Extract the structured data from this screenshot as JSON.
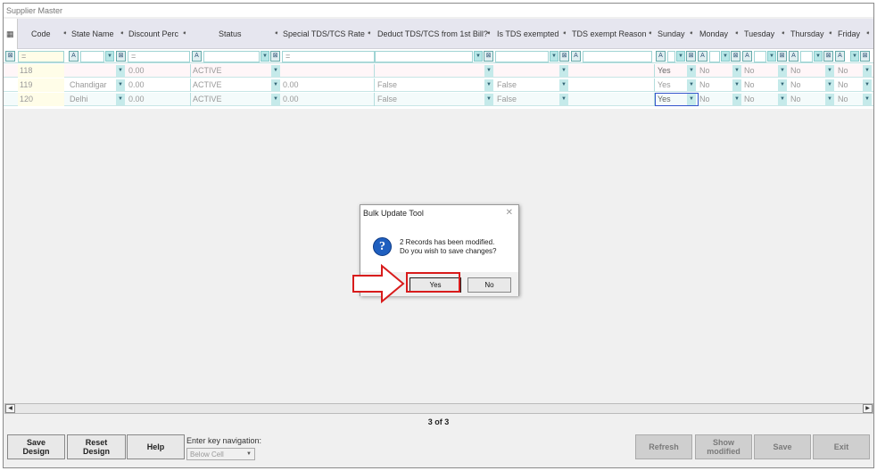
{
  "window": {
    "title": "Supplier Master"
  },
  "grid": {
    "columns": [
      {
        "label": "Code"
      },
      {
        "label": "State Name"
      },
      {
        "label": "Discount Perc"
      },
      {
        "label": "Status"
      },
      {
        "label": "Special TDS/TCS Rate"
      },
      {
        "label": "Deduct TDS/TCS from 1st Bill?"
      },
      {
        "label": "Is TDS exempted"
      },
      {
        "label": "TDS exempt Reason"
      },
      {
        "label": "Sunday"
      },
      {
        "label": "Monday"
      },
      {
        "label": "Tuesday"
      },
      {
        "label": "Thursday"
      },
      {
        "label": "Friday"
      }
    ],
    "filter_equals": "=",
    "rows": [
      {
        "code": "118",
        "state": "",
        "discount": "0.00",
        "status": "ACTIVE",
        "special_rate": "",
        "deduct": "",
        "exempted": "",
        "reason": "",
        "sunday": "Yes",
        "monday": "No",
        "tuesday": "No",
        "thursday": "No",
        "friday": "No"
      },
      {
        "code": "119",
        "state": "Chandigar",
        "discount": "0.00",
        "status": "ACTIVE",
        "special_rate": "0.00",
        "deduct": "False",
        "exempted": "False",
        "reason": "",
        "sunday": "Yes",
        "monday": "No",
        "tuesday": "No",
        "thursday": "No",
        "friday": "No"
      },
      {
        "code": "120",
        "state": "Delhi",
        "discount": "0.00",
        "status": "ACTIVE",
        "special_rate": "0.00",
        "deduct": "False",
        "exempted": "False",
        "reason": "",
        "sunday": "Yes",
        "monday": "No",
        "tuesday": "No",
        "thursday": "No",
        "friday": "No"
      }
    ]
  },
  "pager": {
    "text": "3 of 3"
  },
  "footer": {
    "save_design": "Save\nDesign",
    "reset_design": "Reset\nDesign",
    "help": "Help",
    "nav_label": "Enter key navigation:",
    "nav_value": "Below Cell",
    "refresh": "Refresh",
    "show_modified": "Show\nmodified",
    "save": "Save",
    "exit": "Exit"
  },
  "dialog": {
    "title": "Bulk Update Tool",
    "line1": "2 Records has been modified.",
    "line2": "Do you wish to save changes?",
    "yes": "Yes",
    "no": "No"
  },
  "colors": {
    "highlight": "#d81c1c",
    "grid_accent": "#b6e6e6",
    "question_icon": "#1f5fbf"
  }
}
